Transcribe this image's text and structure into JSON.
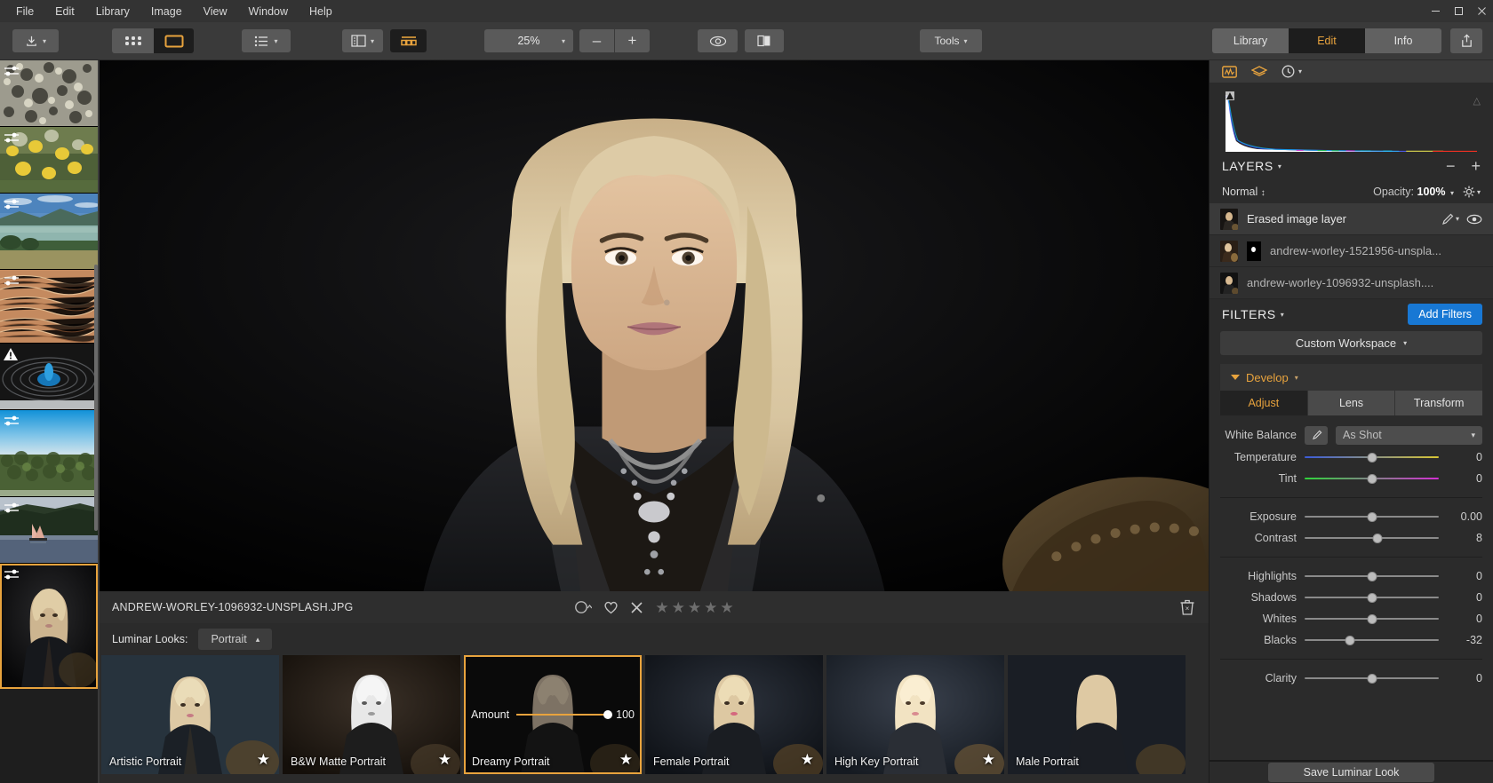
{
  "menubar": {
    "items": [
      "File",
      "Edit",
      "Library",
      "Image",
      "View",
      "Window",
      "Help"
    ],
    "window_controls": {
      "minimize": "–",
      "maximize": "❐",
      "close": "✕"
    }
  },
  "toolbar": {
    "export_icon": "download-icon",
    "grid_view_icon": "grid-icon",
    "single_view_icon": "single-image-icon",
    "list_icon": "list-icon",
    "sidepanel_icon": "side-panel-icon",
    "filmstrip_icon": "filmstrip-icon",
    "zoom_value": "25%",
    "zoom_out": "–",
    "zoom_in": "+",
    "preview_icon": "eye-icon",
    "compare_icon": "compare-split-icon",
    "tools_label": "Tools",
    "tabs": [
      {
        "label": "Library",
        "active": false
      },
      {
        "label": "Edit",
        "active": true
      },
      {
        "label": "Info",
        "active": false
      }
    ],
    "share_icon": "share-icon"
  },
  "filmstrip": {
    "items": [
      {
        "name": "lichen-texture",
        "badge": "adjust-icon",
        "selected": false
      },
      {
        "name": "yellow-flowers",
        "badge": "adjust-icon",
        "selected": false
      },
      {
        "name": "lake-landscape",
        "badge": "adjust-icon",
        "selected": false
      },
      {
        "name": "orange-texture",
        "badge": "adjust-icon",
        "selected": false
      },
      {
        "name": "water-droplet",
        "badge": "warning-icon",
        "selected": false
      },
      {
        "name": "blue-sky-forest",
        "badge": "adjust-icon",
        "selected": false
      },
      {
        "name": "sailboat-lake",
        "badge": "adjust-icon",
        "selected": false
      },
      {
        "name": "portrait-woman",
        "badge": "adjust-icon",
        "selected": true
      }
    ]
  },
  "infobar": {
    "filename": "ANDREW-WORLEY-1096932-UNSPLASH.JPG",
    "flag_icon": "flag-circle-icon",
    "favorite_icon": "heart-icon",
    "reject_icon": "reject-x-icon",
    "stars": 5,
    "star_glyph": "★",
    "delete_icon": "trash-icon"
  },
  "looks": {
    "label": "Luminar Looks:",
    "category": "Portrait",
    "amount_label": "Amount",
    "amount_value": "100",
    "items": [
      {
        "name": "Artistic Portrait",
        "selected": false,
        "favorite": true
      },
      {
        "name": "B&W Matte Portrait",
        "selected": false,
        "favorite": true
      },
      {
        "name": "Dreamy Portrait",
        "selected": true,
        "favorite": true
      },
      {
        "name": "Female Portrait",
        "selected": false,
        "favorite": true
      },
      {
        "name": "High Key Portrait",
        "selected": false,
        "favorite": true
      },
      {
        "name": "Male Portrait",
        "selected": false,
        "favorite": false
      }
    ]
  },
  "right_panel": {
    "tabs": [
      {
        "name": "histogram-tab",
        "icon": "histogram-icon",
        "active": true
      },
      {
        "name": "layers-tab",
        "icon": "layers-icon",
        "active": false
      },
      {
        "name": "history-tab",
        "icon": "clock-icon",
        "active": false
      }
    ],
    "layers": {
      "title": "LAYERS",
      "minus_label": "−",
      "plus_label": "+",
      "blend_mode": "Normal",
      "opacity_label": "Opacity:",
      "opacity_value": "100%",
      "settings_icon": "gear-icon",
      "rows": [
        {
          "name": "Erased image layer",
          "active": true,
          "has_mask": false,
          "brush_icon": "brush-icon",
          "eye_icon": "eye-icon"
        },
        {
          "name": "andrew-worley-1521956-unspla...",
          "active": false,
          "has_mask": true
        },
        {
          "name": "andrew-worley-1096932-unsplash....",
          "active": false,
          "has_mask": false
        }
      ]
    },
    "filters": {
      "title": "FILTERS",
      "add_button": "Add Filters",
      "workspace": "Custom Workspace",
      "develop": "Develop",
      "adjust_tabs": [
        {
          "label": "Adjust",
          "active": true
        },
        {
          "label": "Lens",
          "active": false
        },
        {
          "label": "Transform",
          "active": false
        }
      ],
      "white_balance": {
        "label": "White Balance",
        "eyedropper_icon": "eyedropper-icon",
        "value": "As Shot"
      },
      "sliders": [
        {
          "label": "Temperature",
          "value": "0",
          "pos": 50,
          "kind": "temp"
        },
        {
          "label": "Tint",
          "value": "0",
          "pos": 50,
          "kind": "tint"
        },
        {
          "label": "Exposure",
          "value": "0.00",
          "pos": 50,
          "kind": "plain"
        },
        {
          "label": "Contrast",
          "value": "8",
          "pos": 54,
          "kind": "plain"
        },
        {
          "label": "Highlights",
          "value": "0",
          "pos": 50,
          "kind": "plain"
        },
        {
          "label": "Shadows",
          "value": "0",
          "pos": 50,
          "kind": "plain"
        },
        {
          "label": "Whites",
          "value": "0",
          "pos": 50,
          "kind": "plain"
        },
        {
          "label": "Blacks",
          "value": "-32",
          "pos": 34,
          "kind": "plain"
        },
        {
          "label": "Clarity",
          "value": "0",
          "pos": 50,
          "kind": "plain"
        }
      ]
    },
    "save_look": "Save Luminar Look"
  },
  "colors": {
    "accent": "#e8a33d",
    "add_filters_blue": "#1878d4",
    "panel_bg": "#2b2b2b",
    "toolbar_bg": "#3a3a3a"
  }
}
